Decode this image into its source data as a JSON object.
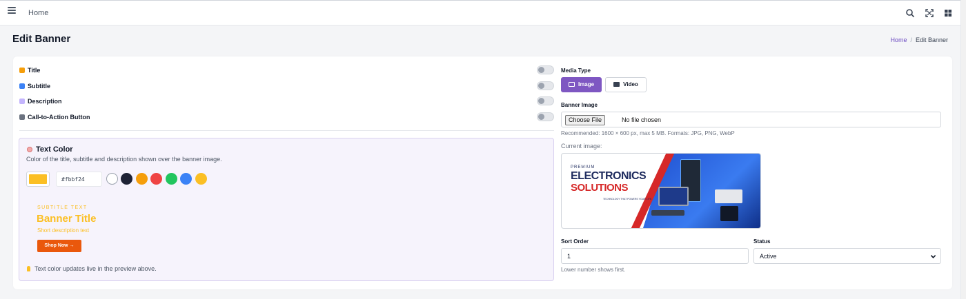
{
  "topbar": {
    "home_label": "Home"
  },
  "page": {
    "title": "Edit Banner"
  },
  "breadcrumb": {
    "home": "Home",
    "separator": "/",
    "current": "Edit Banner"
  },
  "toggles": [
    {
      "label": "Title",
      "on": false,
      "color": "#f59e0b"
    },
    {
      "label": "Subtitle",
      "on": false,
      "color": "#3b82f6"
    },
    {
      "label": "Description",
      "on": false,
      "color": "#c4b5fd"
    },
    {
      "label": "Call-to-Action Button",
      "on": false,
      "color": "#6b7280"
    }
  ],
  "text_color": {
    "heading": "Text Color",
    "description": "Color of the title, subtitle and description shown over the banner image.",
    "hex_value": "#fbbf24",
    "presets": [
      "#ffffff",
      "#1e2235",
      "#f59e0b",
      "#ef4444",
      "#22c55e",
      "#3b82f6",
      "#fbbf24"
    ],
    "preview": {
      "subtitle": "SUBTITLE TEXT",
      "title": "Banner Title",
      "description": "Short description text",
      "button": "Shop Now →"
    },
    "note": "Text color updates live in the preview above."
  },
  "media": {
    "label": "Media Type",
    "image_label": "Image",
    "video_label": "Video",
    "selected": "Image"
  },
  "banner_image": {
    "label": "Banner Image",
    "choose_file": "Choose File",
    "no_file": "No file chosen",
    "help": "Recommended: 1600 × 600 px, max 5 MB. Formats: JPG, PNG, WebP",
    "current_label": "Current image:",
    "preview": {
      "line1": "PREMIUM",
      "line2": "ELECTRONICS",
      "line3": "SOLUTIONS",
      "line4": "TECHNOLOGY THAT POWERS YOUR LIFE."
    }
  },
  "sort_order": {
    "label": "Sort Order",
    "value": "1",
    "help": "Lower number shows first."
  },
  "status": {
    "label": "Status",
    "value": "Active"
  },
  "colors": {
    "accent": "#7e57c2",
    "preview_text": "#fbbf24",
    "cta": "#ea580c"
  }
}
